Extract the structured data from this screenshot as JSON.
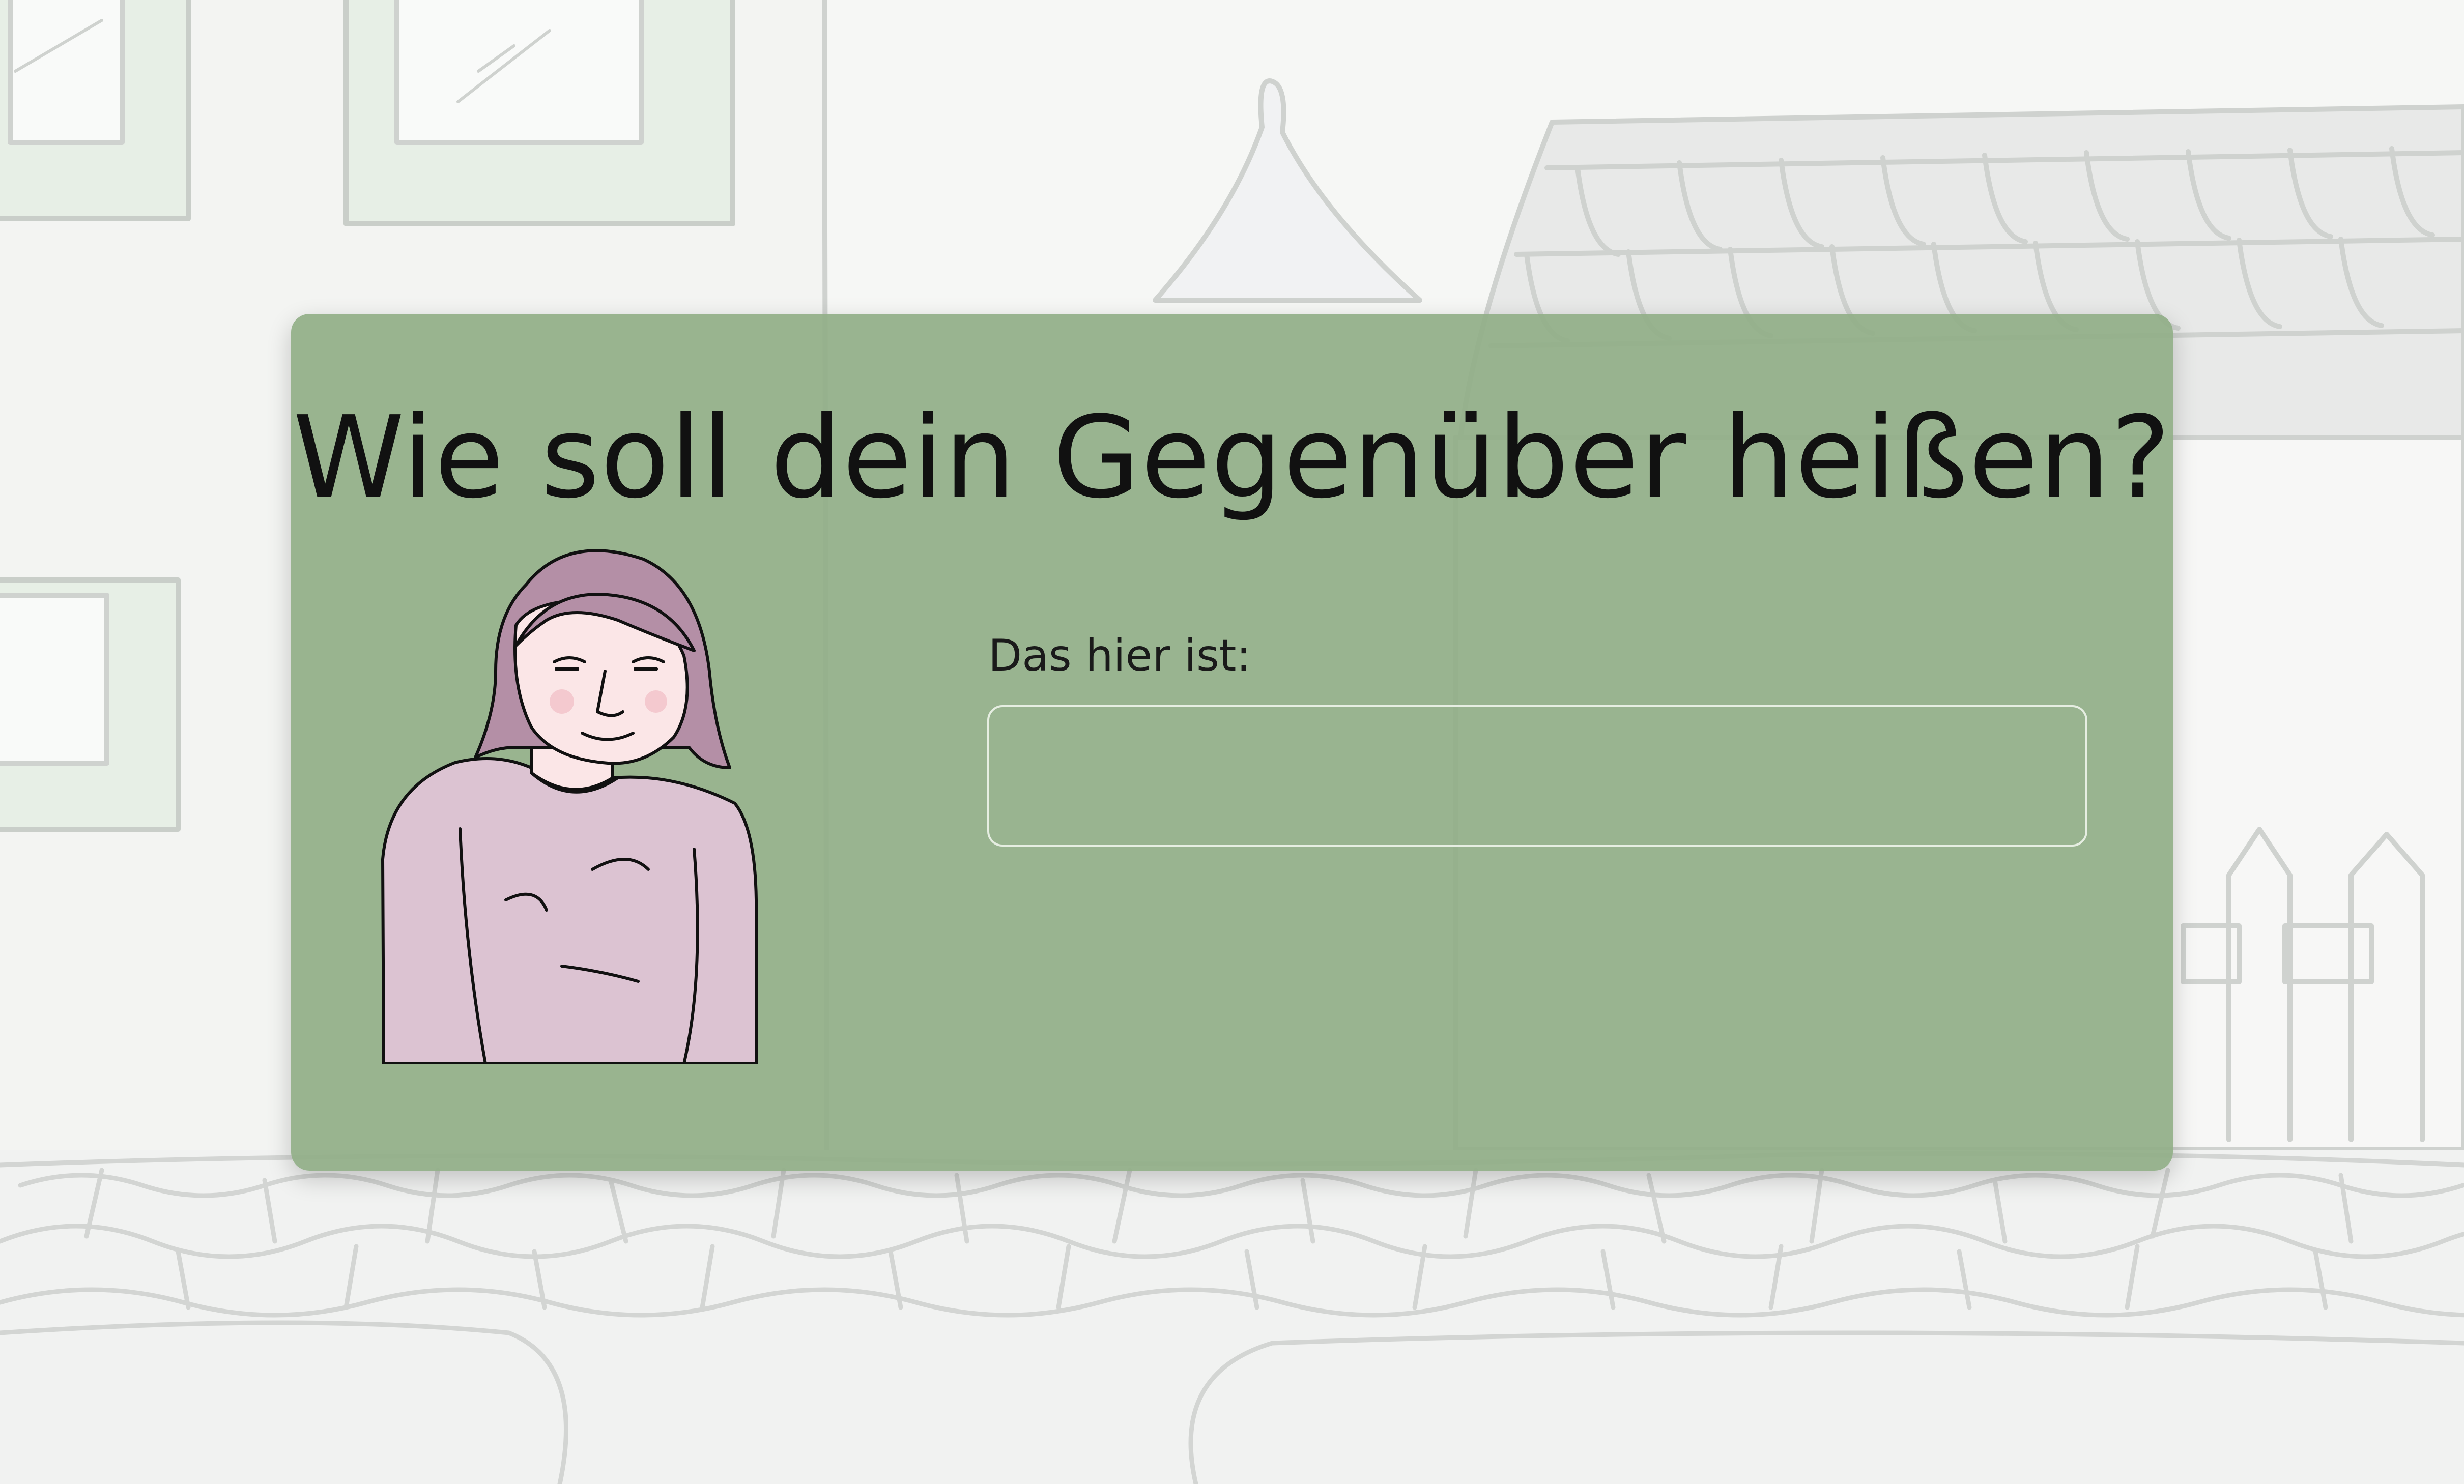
{
  "dialog": {
    "title": "Wie soll dein Gegenüber heißen?",
    "name_label": "Das hier ist:",
    "name_input_value": "",
    "name_input_placeholder": ""
  },
  "colors": {
    "dialog_background": "#91ae88",
    "background_lines": "#cfd2cf",
    "character_shirt": "#dcc3d2",
    "character_hair": "#b48fa6",
    "character_skin": "#fbe6e7"
  },
  "icons": {
    "character": "woman-character-illustration"
  }
}
